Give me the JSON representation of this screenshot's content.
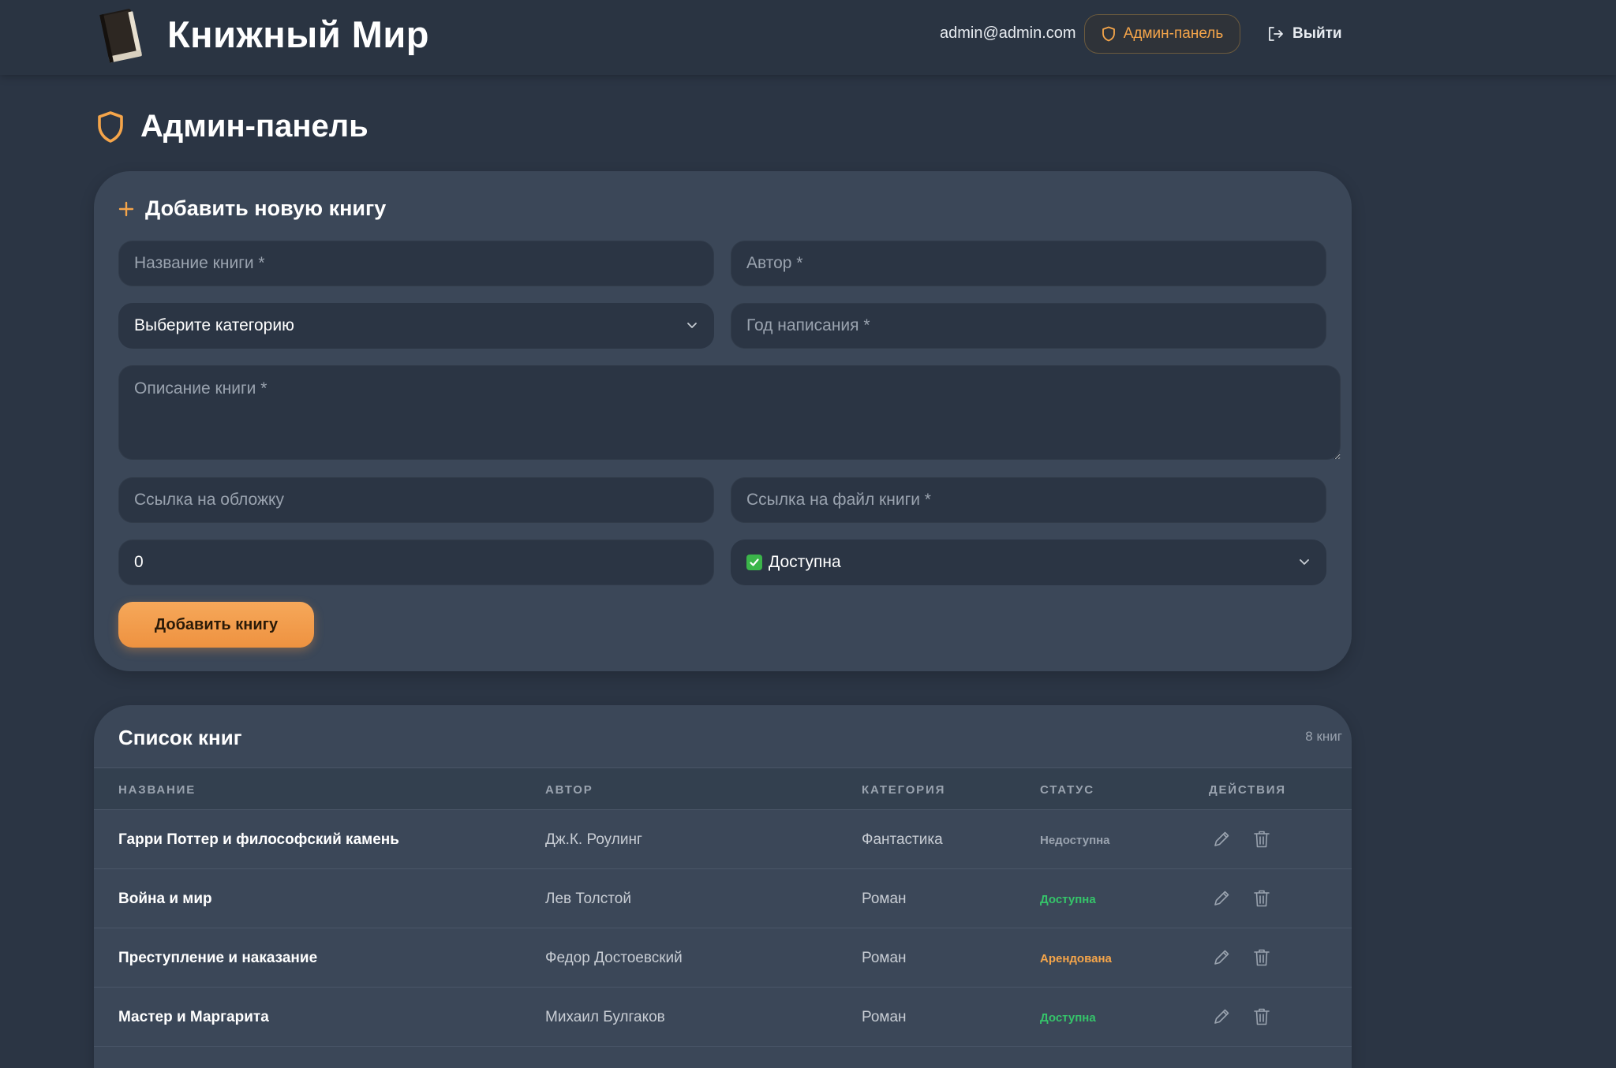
{
  "header": {
    "brand": "Книжный Мир",
    "user_email": "admin@admin.com",
    "admin_label": "Админ-панель",
    "logout_label": "Выйти"
  },
  "page": {
    "title": "Админ-панель"
  },
  "form": {
    "title": "Добавить новую книгу",
    "title_placeholder": "Название книги *",
    "author_placeholder": "Автор *",
    "category_value": "Выберите категорию",
    "year_placeholder": "Год написания *",
    "description_placeholder": "Описание книги *",
    "cover_placeholder": "Ссылка на обложку",
    "file_placeholder": "Ссылка на файл книги *",
    "number_value": "0",
    "status_value": "Доступна",
    "submit_label": "Добавить книгу"
  },
  "list": {
    "title": "Список книг",
    "count": "8 книг",
    "columns": [
      "НАЗВАНИЕ",
      "АВТОР",
      "КАТЕГОРИЯ",
      "СТАТУС",
      "ДЕЙСТВИЯ"
    ],
    "rows": [
      {
        "title": "Гарри Поттер и философский камень",
        "author": "Дж.К. Роулинг",
        "category": "Фантастика",
        "status": "Недоступна",
        "status_color": "#9aa3af"
      },
      {
        "title": "Война и мир",
        "author": "Лев Толстой",
        "category": "Роман",
        "status": "Доступна",
        "status_color": "#35c46a"
      },
      {
        "title": "Преступление и наказание",
        "author": "Федор Достоевский",
        "category": "Роман",
        "status": "Арендована",
        "status_color": "#f5a54a"
      },
      {
        "title": "Мастер и Маргарита",
        "author": "Михаил Булгаков",
        "category": "Роман",
        "status": "Доступна",
        "status_color": "#35c46a"
      }
    ]
  },
  "colors": {
    "accent": "#f5a54a",
    "background": "#2b3544",
    "card": "#3b4758"
  }
}
